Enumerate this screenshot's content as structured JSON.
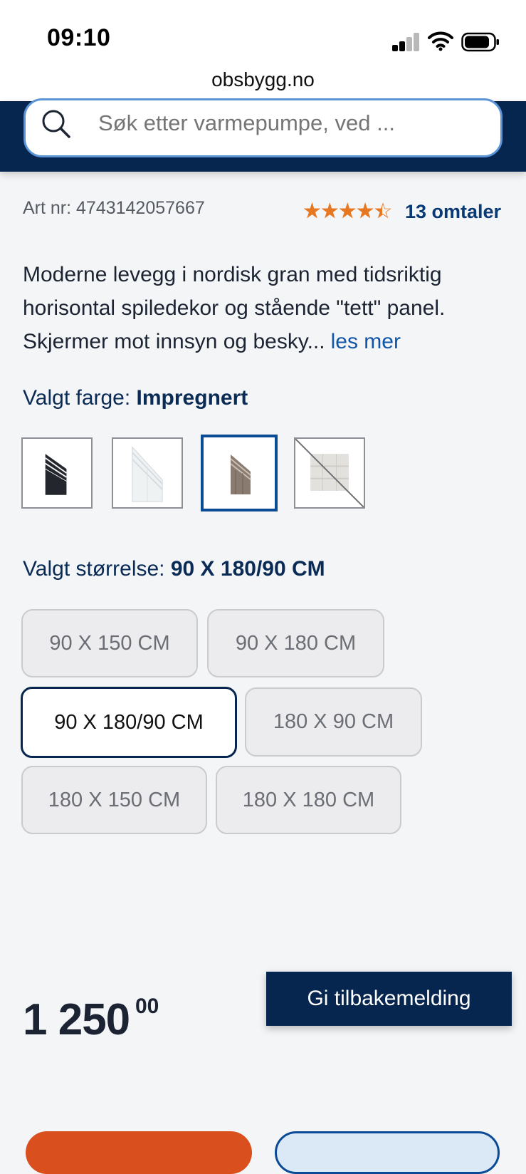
{
  "status_bar": {
    "time": "09:10"
  },
  "browser": {
    "url": "obsbygg.no"
  },
  "search": {
    "placeholder": "Søk etter varmepumpe, ved ..."
  },
  "product": {
    "art_nr": "Art nr: 4743142057667",
    "rating": {
      "value": 4,
      "max": 5,
      "reviews_label": "13 omtaler"
    },
    "description": "Moderne levegg i nordisk gran med tidsriktig horisontal spiledekor og stående \"tett\" panel. Skjermer mot innsyn og besky...",
    "read_more": "les mer",
    "color": {
      "label": "Valgt farge:",
      "selected": "Impregnert",
      "options": [
        {
          "name": "black",
          "selected": false,
          "available": true
        },
        {
          "name": "white",
          "selected": false,
          "available": true
        },
        {
          "name": "impregnert",
          "selected": true,
          "available": true
        },
        {
          "name": "grey",
          "selected": false,
          "available": false
        }
      ]
    },
    "size": {
      "label": "Valgt størrelse:",
      "selected": "90 X 180/90 CM",
      "options": [
        "90 X 150 CM",
        "90 X 180 CM",
        "90 X 180/90 CM",
        "180 X 90 CM",
        "180 X 150 CM",
        "180 X 180 CM"
      ]
    },
    "price": {
      "main": "1 250",
      "cents": "00"
    }
  },
  "feedback_button": {
    "label": "Gi tilbakemelding"
  },
  "colors": {
    "navy": "#06264f",
    "accent_orange": "#e87722",
    "cta_orange": "#d9501e",
    "link_blue": "#1155a8"
  }
}
